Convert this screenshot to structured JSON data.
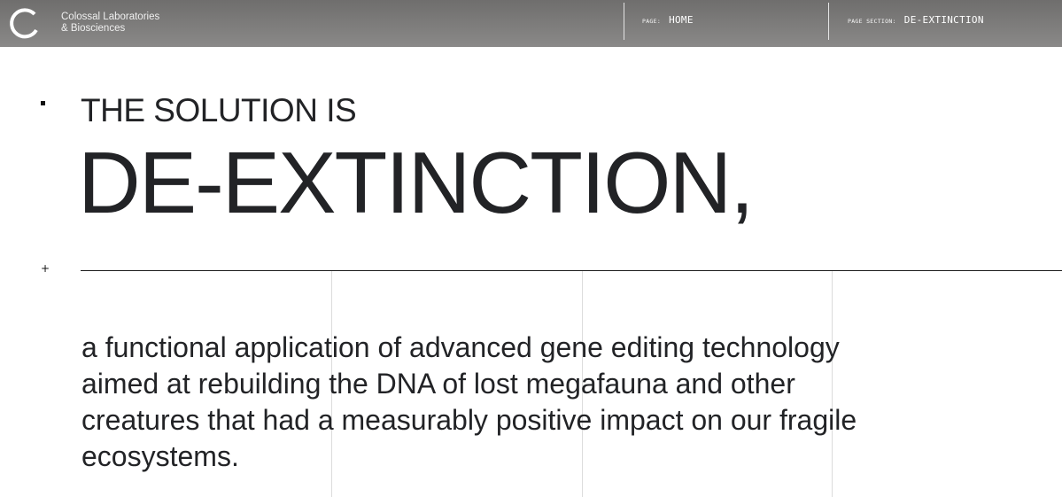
{
  "header": {
    "brand_line1": "Colossal Laboratories",
    "brand_line2": "& Biosciences",
    "logo_icon": "ring-logo-icon",
    "page_key": "PAGE:",
    "page_value": "HOME",
    "section_key": "PAGE SECTION:",
    "section_value": "DE-EXTINCTION"
  },
  "hero": {
    "eyebrow": "THE SOLUTION IS",
    "headline": "DE-EXTINCTION,"
  },
  "body": {
    "text": "a functional application of advanced gene editing technology aimed at rebuilding the DNA of lost megafauna and other creatures that had a measurably positive impact on our fragile ecosystems."
  },
  "markers": {
    "plus": "+"
  },
  "colors": {
    "header_bg": "#7d7c7b",
    "text": "#222326",
    "grid": "#dcdcdc"
  }
}
